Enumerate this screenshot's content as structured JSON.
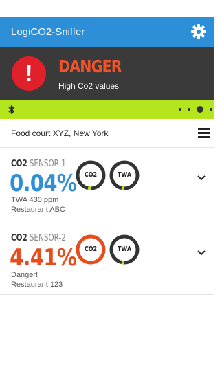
{
  "app": {
    "title": "LogiCO2-Sniffer",
    "accent_color": "#2d8fd8",
    "settings_icon": "gear-icon"
  },
  "alert": {
    "icon": "exclamation-icon",
    "title": "DANGER",
    "message": "High Co2 values",
    "title_color": "#f0532a",
    "icon_color": "#e0202a"
  },
  "status_bar": {
    "icon": "bluetooth-icon",
    "color": "#b5e61d",
    "pager_dots": 4,
    "active_dot": 3
  },
  "location": {
    "name": "Food court XYZ, New York",
    "menu_icon": "hamburger-icon"
  },
  "sensors": [
    {
      "gas": "CO2",
      "id": "SENSOR-1",
      "value": "0.04%",
      "status": "TWA 430 ppm",
      "place": "Restaurant ABC",
      "value_color": "#2d8fd8",
      "gauges": [
        {
          "label": "CO2",
          "ring_color": "#333333",
          "marker_color": "#b5e61d"
        },
        {
          "label": "TWA",
          "ring_color": "#333333",
          "marker_color": "#b5e61d"
        }
      ]
    },
    {
      "gas": "CO2",
      "id": "SENSOR-2",
      "value": "4.41%",
      "status": "Danger!",
      "place": "Restaurant 123",
      "value_color": "#e74c1c",
      "gauges": [
        {
          "label": "CO2",
          "ring_color": "#e74c1c",
          "marker_color": "#e74c1c"
        },
        {
          "label": "TWA",
          "ring_color": "#333333",
          "marker_color": "#b5e61d"
        }
      ]
    }
  ]
}
